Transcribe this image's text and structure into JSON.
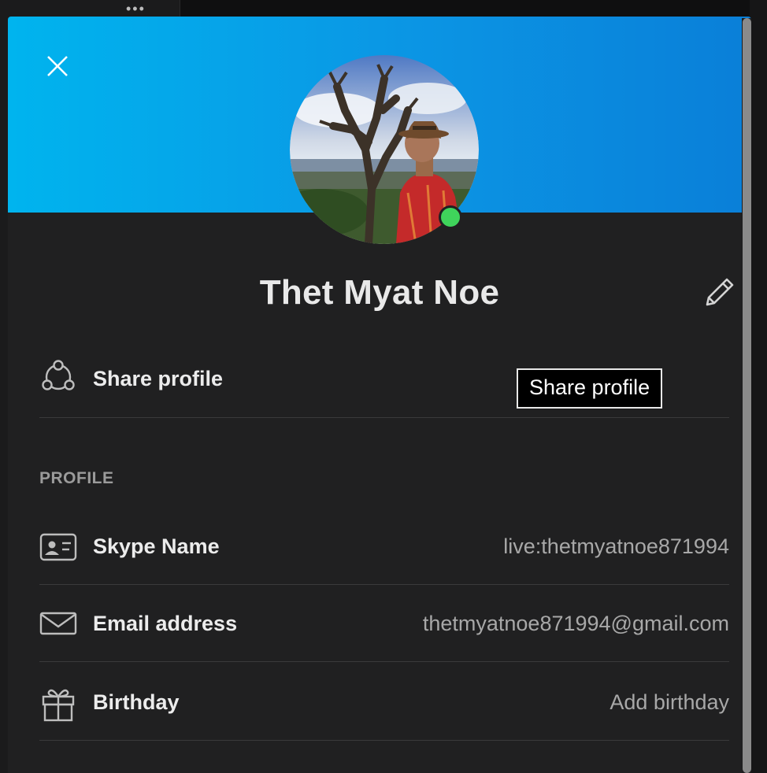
{
  "profile": {
    "name": "Thet Myat Noe",
    "status_color": "#3fd45b"
  },
  "banner": {
    "gradient_start": "#00b4ee",
    "gradient_end": "#0a7fd8"
  },
  "share": {
    "label": "Share profile",
    "icon": "share-nodes-icon"
  },
  "tooltip": {
    "text": "Share profile"
  },
  "section": {
    "title": "PROFILE"
  },
  "fields": [
    {
      "label": "Skype Name",
      "value": "live:thetmyatnoe871994",
      "icon": "id-card-icon"
    },
    {
      "label": "Email address",
      "value": "thetmyatnoe871994@gmail.com",
      "icon": "envelope-icon"
    },
    {
      "label": "Birthday",
      "value": "Add birthday",
      "icon": "gift-icon"
    }
  ],
  "icons": {
    "close": "close-icon",
    "edit": "pencil-icon"
  }
}
